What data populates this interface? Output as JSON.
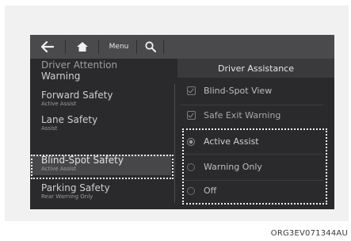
{
  "topbar": {
    "menu_label": "Menu",
    "back_icon": "back-arrow-icon",
    "home_icon": "home-icon",
    "search_icon": "search-icon"
  },
  "header": {
    "title": "Driver Assistance"
  },
  "left_menu": {
    "items": [
      {
        "label": "Driver Attention",
        "sub": ""
      },
      {
        "label": "Warning",
        "sub": ""
      },
      {
        "label": "Forward Safety",
        "sub": "Active Assist"
      },
      {
        "label": "Lane Safety",
        "sub": "Assist"
      },
      {
        "label": "Blind-Spot Safety",
        "sub": "Active Assist"
      },
      {
        "label": "Parking Safety",
        "sub": "Rear Warning Only"
      }
    ],
    "selected_index": 4
  },
  "right_menu": {
    "checkbox_items": [
      {
        "label": "Blind-Spot View",
        "checked": true
      },
      {
        "label": "Safe Exit Warning",
        "checked": true
      }
    ],
    "radio_options": [
      {
        "label": "Active Assist",
        "selected": true
      },
      {
        "label": "Warning Only",
        "selected": false
      },
      {
        "label": "Off",
        "selected": false
      }
    ]
  },
  "caption": "ORG3EV071344AU"
}
